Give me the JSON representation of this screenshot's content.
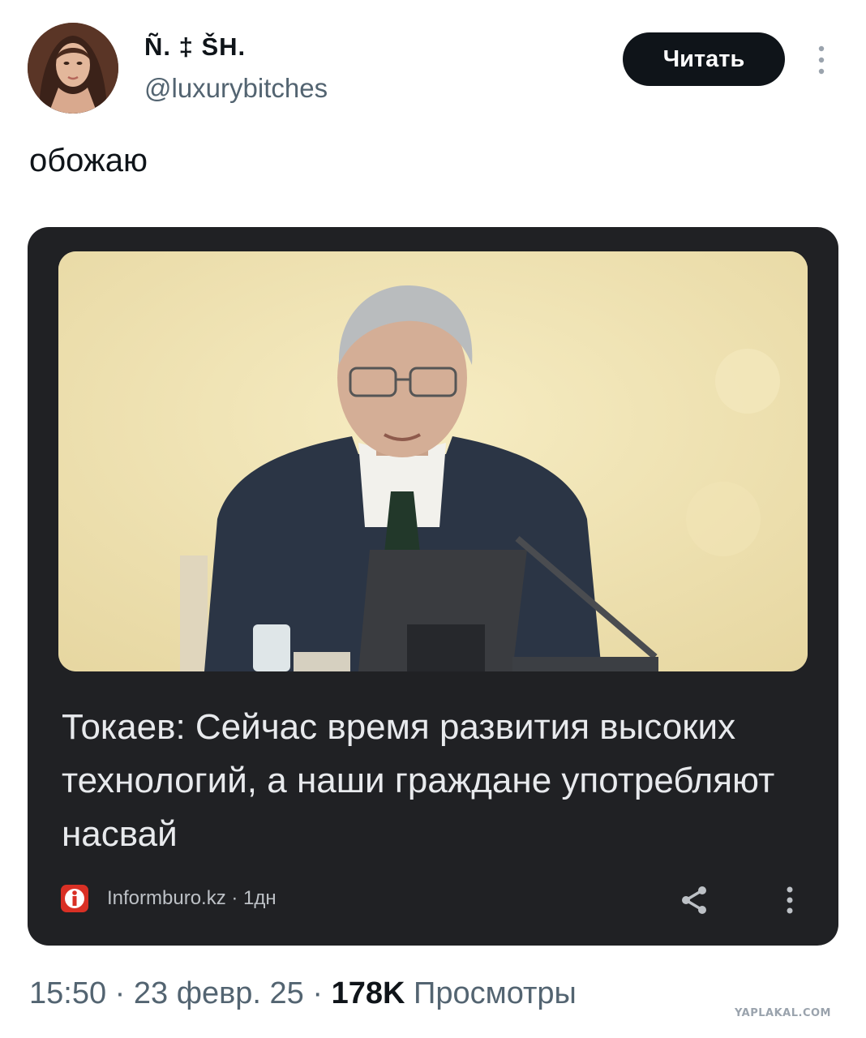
{
  "colors": {
    "background": "#ffffff",
    "text_primary": "#0f1419",
    "text_secondary": "#536471",
    "follow_button_bg": "#0f1419",
    "card_bg": "#202124",
    "card_headline": "#e8eaed",
    "source_logo": "#d93025"
  },
  "author": {
    "display_name": "Ñ. ‡ ŠH.",
    "handle": "@luxurybitches",
    "avatar_icon": "user-avatar-photo"
  },
  "header": {
    "follow_label": "Читать",
    "more_icon": "vertical-ellipsis-icon"
  },
  "tweet": {
    "text": "обожаю"
  },
  "card": {
    "image_icon": "news-photo",
    "headline": "Токаев: Сейчас время развития высоких технологий, а наши граждане употребляют насвай",
    "source": "Informburo.kz · 1дн",
    "source_icon": "informburo-logo-icon",
    "share_icon": "share-icon",
    "more_icon": "vertical-ellipsis-icon"
  },
  "meta": {
    "time": "15:50",
    "date": "23 февр. 25",
    "separator": "·",
    "views_count": "178K",
    "views_label": "Просмотры"
  },
  "watermark": "YAPLAKAL.COM"
}
